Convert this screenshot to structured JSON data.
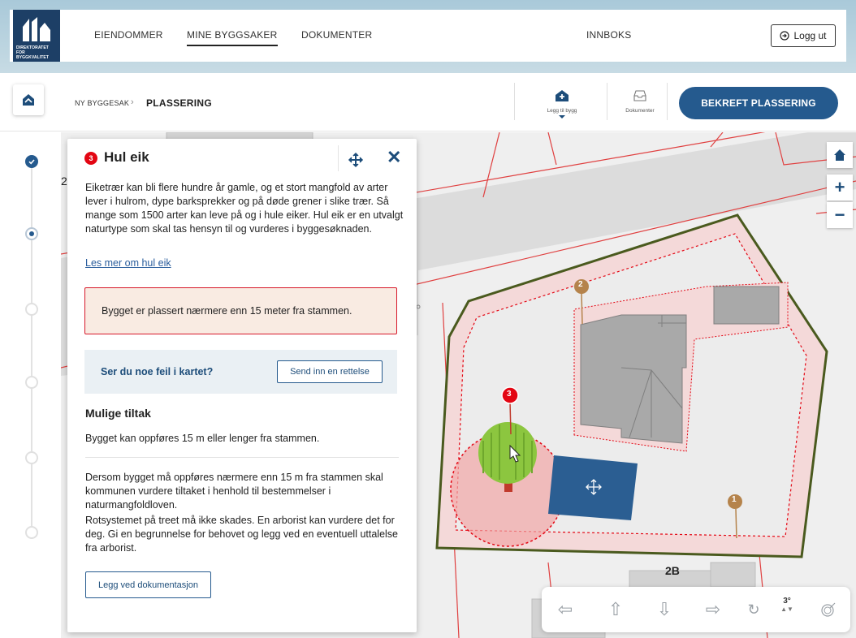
{
  "brand": {
    "logo_text": "DIREKTORATET FOR BYGGKVALITET"
  },
  "topnav": {
    "items": [
      {
        "label": "EIENDOMMER",
        "active": false
      },
      {
        "label": "MINE BYGGSAKER",
        "active": true
      },
      {
        "label": "DOKUMENTER",
        "active": false
      }
    ],
    "inbox_label": "INNBOKS",
    "logout_label": "Logg ut"
  },
  "breadcrumb": {
    "parent": "NY BYGGESAK",
    "separator": "›",
    "current": "PLASSERING"
  },
  "toolbar": {
    "add_building_label": "Legg til bygg",
    "documents_label": "Dokumenter",
    "confirm_label": "BEKREFT PLASSERING"
  },
  "stepper": {
    "steps": [
      "done",
      "current",
      "todo",
      "todo",
      "todo",
      "todo",
      "todo"
    ]
  },
  "panel": {
    "badge": "3",
    "title": "Hul eik",
    "description": "Eiketrær kan bli flere hundre år gamle, og et stort mangfold av arter lever i hulrom, dype barksprekker og på døde grener i slike trær. Så mange som 1500 arter kan leve på og i hule eiker. Hul eik er en utvalgt naturtype som skal tas hensyn til og vurderes i byggesøknaden.",
    "link": "Les mer om hul eik",
    "warning": "Bygget er plassert nærmere enn 15 meter fra stammen.",
    "report_question": "Ser du noe feil i kartet?",
    "report_button": "Send inn en rettelse",
    "measures_heading": "Mulige tiltak",
    "measure_1": "Bygget kan oppføres 15 m eller lenger fra stammen.",
    "measure_2": "Dersom bygget må oppføres nærmere enn 15 m fra stammen skal kommunen vurdere tiltaket i henhold til bestemmelser i naturmangfoldloven.",
    "measure_3": "Rotsystemet på treet må ikke skades. En arborist kan vurdere det for deg. Gi en begrunnelse for behovet og legg ved en eventuell uttalelse fra arborist.",
    "doc_button": "Legg ved dokumentasjon"
  },
  "map": {
    "markers": [
      {
        "number": "1",
        "color": "#b5834b"
      },
      {
        "number": "2",
        "color": "#b5834b"
      },
      {
        "number": "3",
        "color": "#e30613"
      }
    ],
    "address_label": "2B",
    "side_label": "2",
    "tilt": "3°",
    "controls": [
      "home-icon",
      "zoom-in-icon",
      "zoom-out-icon"
    ],
    "pad": [
      "arrow-left-icon",
      "arrow-up-icon",
      "arrow-down-icon",
      "arrow-right-icon",
      "rotate-icon",
      "compass-icon"
    ]
  },
  "colors": {
    "primary": "#255a8e",
    "warning_border": "#d7182a",
    "warning_bg": "#f9ebe2",
    "plot_outline": "#4a5a1e",
    "building_blue": "#2b5e92",
    "danger_zone": "#e30613"
  }
}
